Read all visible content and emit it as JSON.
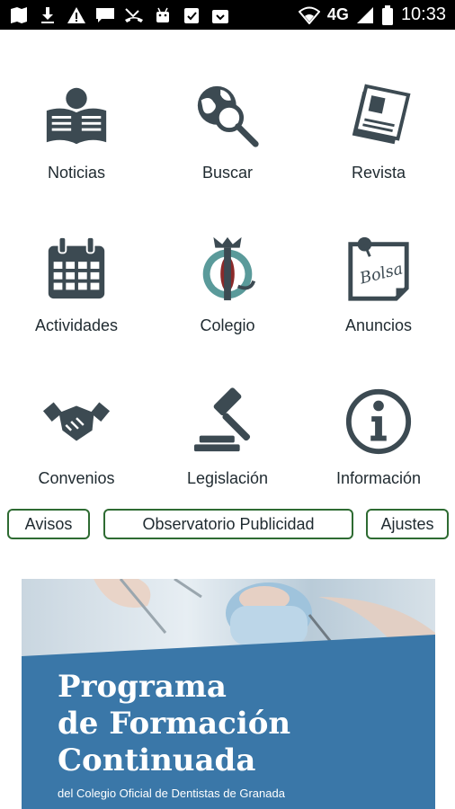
{
  "status_bar": {
    "network": "4G",
    "time": "10:33",
    "icons": [
      "maps-icon",
      "download-icon",
      "warning-icon",
      "message-icon",
      "missed-call-icon",
      "android-icon",
      "clipboard-check-icon",
      "inbox-icon",
      "wifi-icon",
      "signal-icon",
      "battery-icon"
    ]
  },
  "menu": {
    "items": [
      {
        "label": "Noticias",
        "icon": "newspaper-reader-icon"
      },
      {
        "label": "Buscar",
        "icon": "globe-search-icon"
      },
      {
        "label": "Revista",
        "icon": "magazine-icon"
      },
      {
        "label": "Actividades",
        "icon": "calendar-icon"
      },
      {
        "label": "Colegio",
        "icon": "college-emblem-icon"
      },
      {
        "label": "Anuncios",
        "icon": "bulletin-note-icon"
      },
      {
        "label": "Convenios",
        "icon": "handshake-icon"
      },
      {
        "label": "Legislación",
        "icon": "gavel-icon"
      },
      {
        "label": "Información",
        "icon": "info-icon"
      }
    ]
  },
  "buttons": {
    "avisos": "Avisos",
    "observatorio": "Observatorio Publicidad",
    "ajustes": "Ajustes"
  },
  "banner": {
    "title_line1": "Programa",
    "title_line2": "de Formación",
    "title_line3": "Continuada",
    "subtitle": "del Colegio Oficial de Dentistas de Granada"
  },
  "colors": {
    "icon": "#3c4a52",
    "accent_teal": "#5a9a9a",
    "button_border": "#2e6b32",
    "banner_blue": "#3a77a8"
  }
}
